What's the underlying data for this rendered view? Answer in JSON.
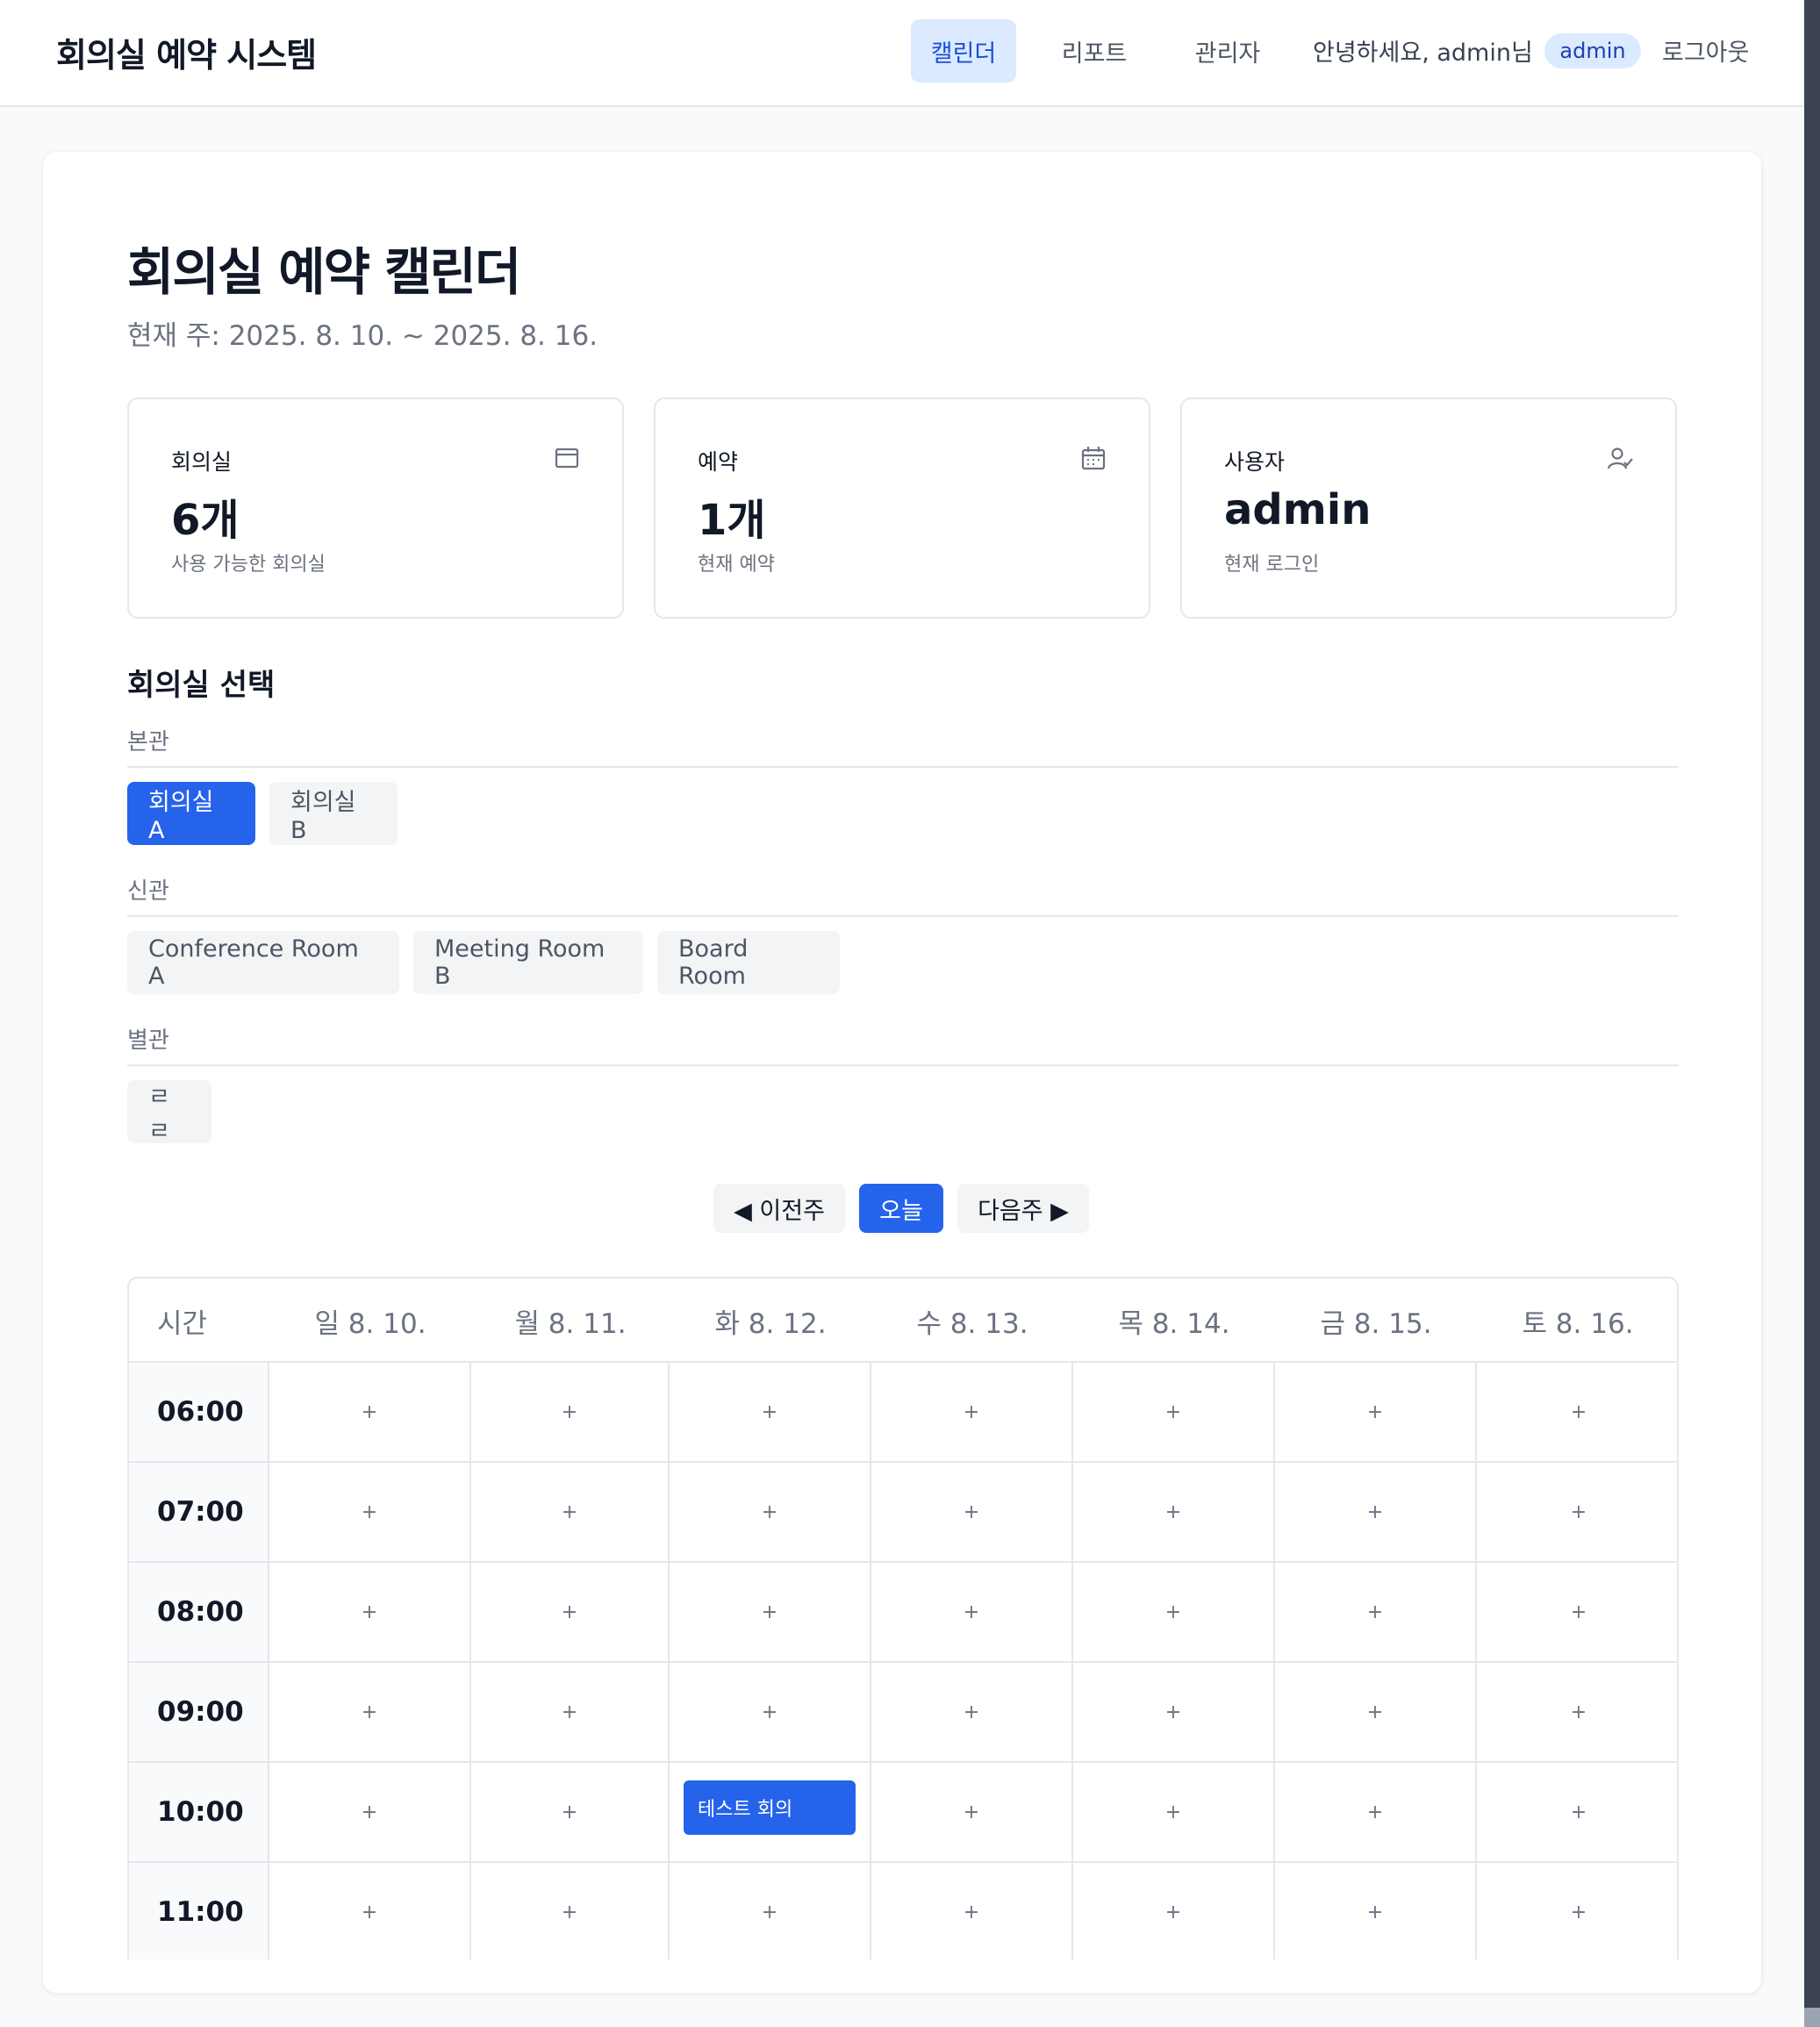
{
  "header": {
    "brand": "회의실 예약 시스템",
    "nav": [
      {
        "label": "캘린더",
        "active": true
      },
      {
        "label": "리포트",
        "active": false
      },
      {
        "label": "관리자",
        "active": false
      }
    ],
    "greeting": "안녕하세요, admin님",
    "role_badge": "admin",
    "logout": "로그아웃"
  },
  "page": {
    "title": "회의실 예약 캘린더",
    "subtitle": "현재 주: 2025. 8. 10. ~ 2025. 8. 16."
  },
  "stats": [
    {
      "label": "회의실",
      "value": "6개",
      "desc": "사용 가능한 회의실",
      "icon": "room-icon"
    },
    {
      "label": "예약",
      "value": "1개",
      "desc": "현재 예약",
      "icon": "calendar-icon"
    },
    {
      "label": "사용자",
      "value": "admin",
      "desc": "현재 로그인",
      "icon": "user-check-icon"
    }
  ],
  "room_select": {
    "title": "회의실 선택",
    "groups": [
      {
        "label": "본관",
        "rooms": [
          {
            "name": "회의실 A",
            "selected": true
          },
          {
            "name": "회의실 B",
            "selected": false
          }
        ]
      },
      {
        "label": "신관",
        "rooms": [
          {
            "name": "Conference Room A",
            "selected": false
          },
          {
            "name": "Meeting Room B",
            "selected": false
          },
          {
            "name": "Board Room",
            "selected": false
          }
        ]
      },
      {
        "label": "별관",
        "rooms": [
          {
            "name": "ㄹㄹ",
            "selected": false
          }
        ]
      }
    ]
  },
  "week_nav": {
    "prev": "◀ 이전주",
    "today": "오늘",
    "next": "다음주 ▶"
  },
  "calendar": {
    "time_header": "시간",
    "days": [
      "일 8. 10.",
      "월 8. 11.",
      "화 8. 12.",
      "수 8. 13.",
      "목 8. 14.",
      "금 8. 15.",
      "토 8. 16."
    ],
    "times": [
      "06:00",
      "07:00",
      "08:00",
      "09:00",
      "10:00",
      "11:00"
    ],
    "empty_slot": "+",
    "events": [
      {
        "title": "테스트 회의",
        "day_index": 2,
        "time_index": 4
      }
    ]
  },
  "colors": {
    "accent": "#2563eb",
    "accent_light": "#dbeafe",
    "border": "#e5e7eb",
    "muted_text": "#6b7280"
  }
}
